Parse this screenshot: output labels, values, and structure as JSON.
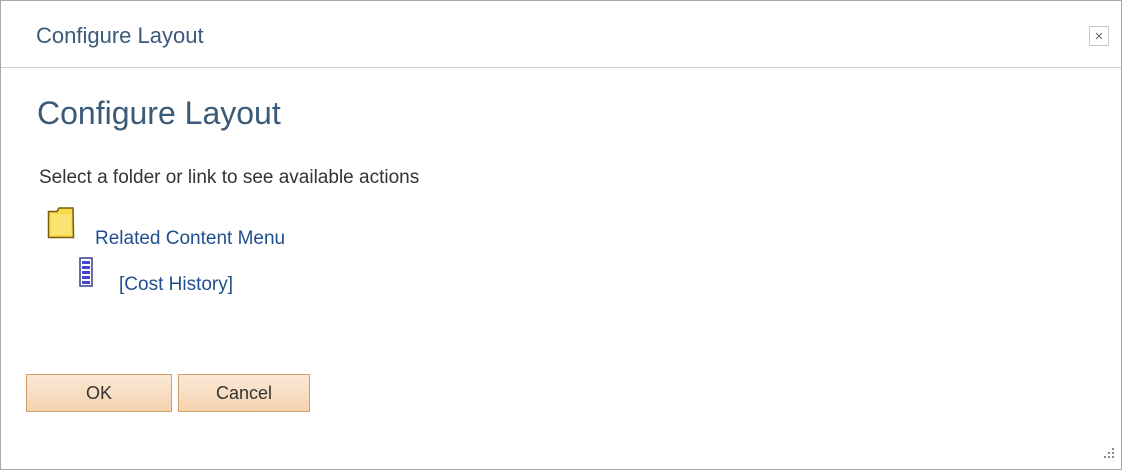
{
  "dialog": {
    "window_title": "Configure Layout",
    "close_glyph": "×",
    "close_icon": "close-icon"
  },
  "main": {
    "page_title": "Configure Layout",
    "instructions": "Select a folder or link to see available actions"
  },
  "tree": {
    "folder": {
      "icon": "folder-icon",
      "label": "Related Content Menu"
    },
    "children": [
      {
        "icon": "document-icon",
        "label": "[Cost History]"
      }
    ]
  },
  "buttons": {
    "ok_label": "OK",
    "cancel_label": "Cancel"
  },
  "colors": {
    "title_text": "#3b5a7a",
    "link": "#1f4f8f",
    "button_fill": "#f5d2ae",
    "button_border": "#d29f6c",
    "folder_fill": "#f7d94c"
  }
}
